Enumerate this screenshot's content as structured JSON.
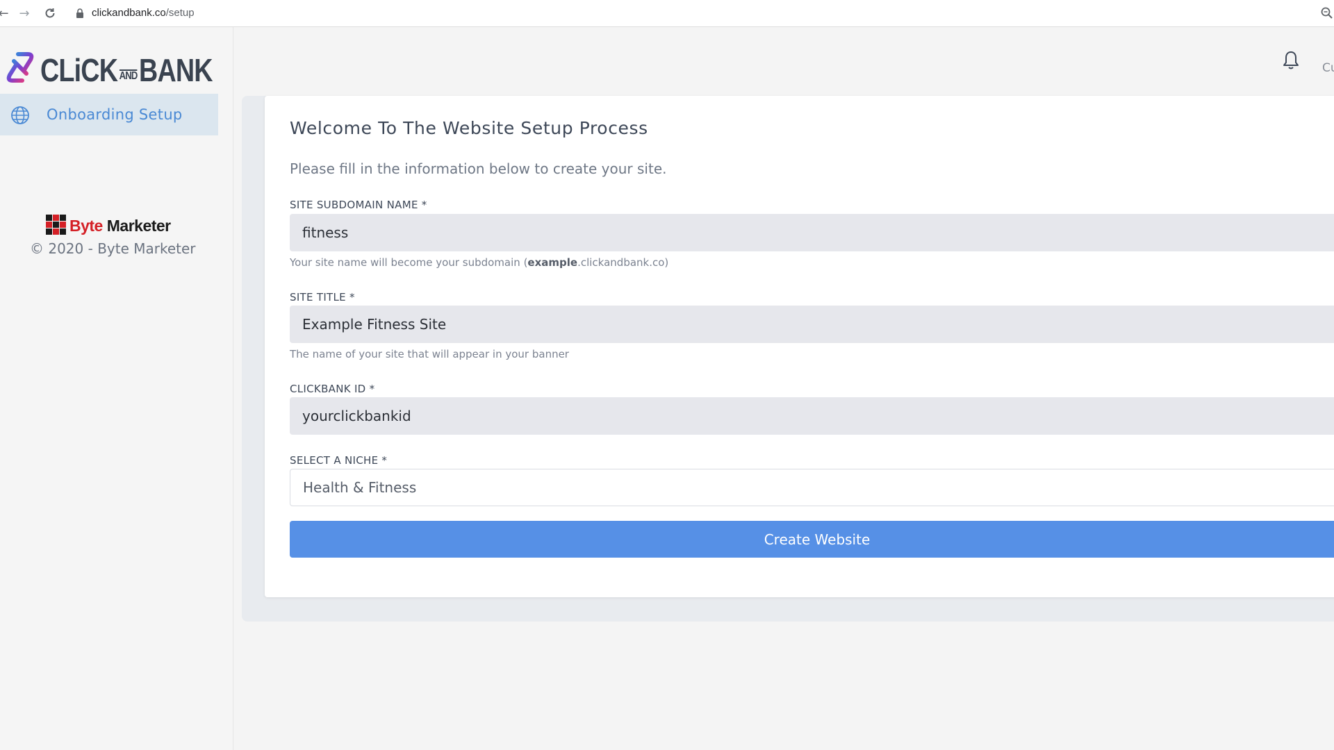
{
  "browser": {
    "url_domain": "clickandbank.co",
    "url_path": "/setup"
  },
  "sidebar": {
    "logo_left": "CLiCK",
    "logo_and": "AND",
    "logo_right": "BANK",
    "nav_item_label": "Onboarding Setup",
    "footer_logo_byte": "Byte",
    "footer_logo_marketer": "Marketer",
    "copyright": "© 2020 - Byte Marketer"
  },
  "header": {
    "user_truncated": "Cu"
  },
  "form": {
    "title": "Welcome To The Website Setup Process",
    "subtitle": "Please fill in the information below to create your site.",
    "subdomain": {
      "label": "SITE SUBDOMAIN NAME *",
      "value": "fitness",
      "help_prefix": "Your site name will become your subdomain (",
      "help_bold": "example",
      "help_suffix": ".clickandbank.co)"
    },
    "site_title": {
      "label": "SITE TITLE *",
      "value": "Example Fitness Site",
      "help": "The name of your site that will appear in your banner"
    },
    "clickbank_id": {
      "label": "CLICKBANK ID *",
      "value": "yourclickbankid"
    },
    "niche": {
      "label": "SELECT A NICHE *",
      "value": "Health & Fitness"
    },
    "submit_label": "Create Website"
  },
  "colors": {
    "accent": "#5690e6",
    "nav_active_bg": "#dbe6ef",
    "nav_active_text": "#4a89d4",
    "brand_red": "#d42026"
  }
}
